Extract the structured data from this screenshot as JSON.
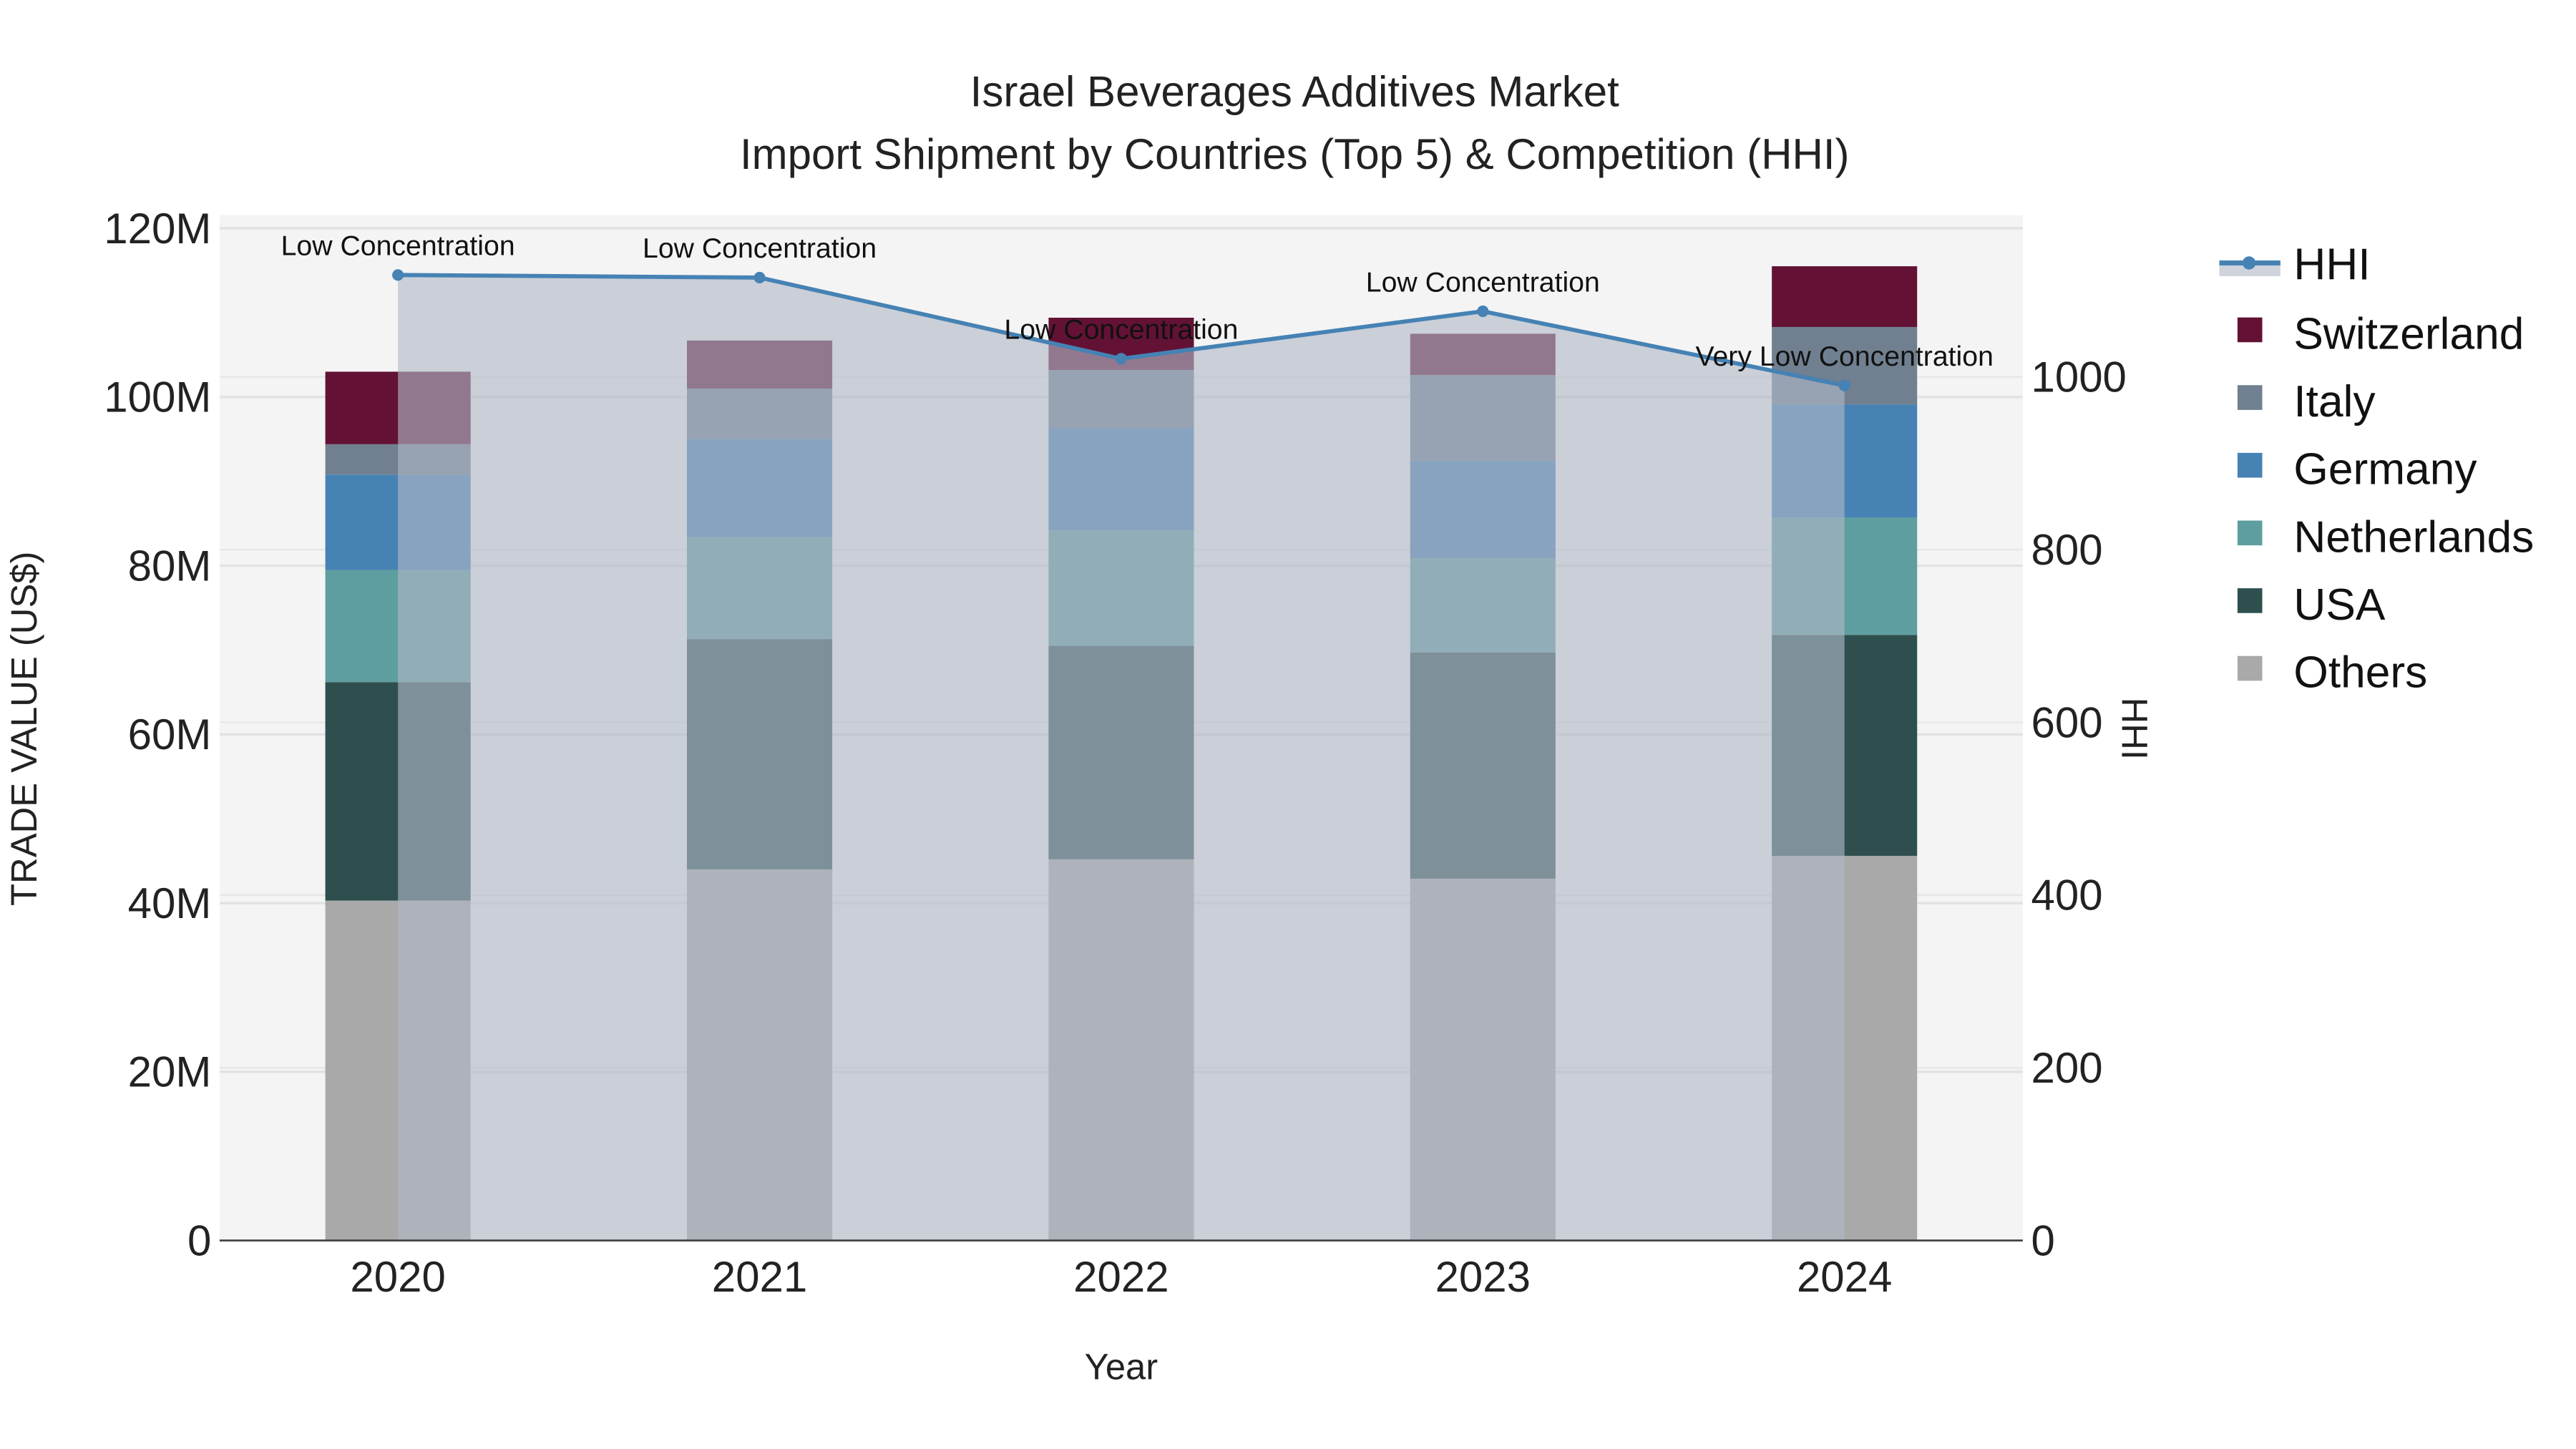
{
  "chart_data": {
    "type": "bar",
    "title_line1": "Israel Beverages Additives Market",
    "title_line2": "Import Shipment by Countries (Top 5) & Competition (HHI)",
    "xlabel": "Year",
    "ylabel": "TRADE VALUE (US$)",
    "y2label": "HHI",
    "ylim": [
      0,
      120000000
    ],
    "y2lim": [
      0,
      1150
    ],
    "yticks": [
      "0",
      "20M",
      "40M",
      "60M",
      "80M",
      "100M",
      "120M"
    ],
    "y2ticks": [
      "0",
      "200",
      "400",
      "600",
      "800",
      "1000"
    ],
    "categories": [
      "2020",
      "2021",
      "2022",
      "2023",
      "2024"
    ],
    "series": [
      {
        "name": "Others",
        "color": "#a9a9a9",
        "values": [
          40.3,
          44.0,
          45.2,
          42.9,
          45.6
        ]
      },
      {
        "name": "USA",
        "color": "#2f4f4f",
        "values": [
          25.9,
          27.3,
          25.3,
          26.8,
          26.2
        ]
      },
      {
        "name": "Netherlands",
        "color": "#5f9ea0",
        "values": [
          13.3,
          12.1,
          13.7,
          11.2,
          13.9
        ]
      },
      {
        "name": "Germany",
        "color": "#4682b4",
        "values": [
          11.3,
          11.6,
          12.1,
          11.5,
          13.4
        ]
      },
      {
        "name": "Italy",
        "color": "#708090",
        "values": [
          3.6,
          6.0,
          6.9,
          10.2,
          9.2
        ]
      },
      {
        "name": "Switzerland",
        "color": "#631236",
        "values": [
          8.6,
          5.7,
          6.2,
          4.9,
          7.2
        ]
      }
    ],
    "value_unit": "M US$",
    "hhi": {
      "name": "HHI",
      "color": "#4682b4",
      "values": [
        1118,
        1115,
        1021,
        1076,
        990
      ],
      "labels": [
        "Low Concentration",
        "Low Concentration",
        "Low Concentration",
        "Low Concentration",
        "Very Low Concentration"
      ]
    },
    "legend": [
      "HHI",
      "Switzerland",
      "Italy",
      "Germany",
      "Netherlands",
      "USA",
      "Others"
    ],
    "legend_position": "right",
    "grid": true
  }
}
